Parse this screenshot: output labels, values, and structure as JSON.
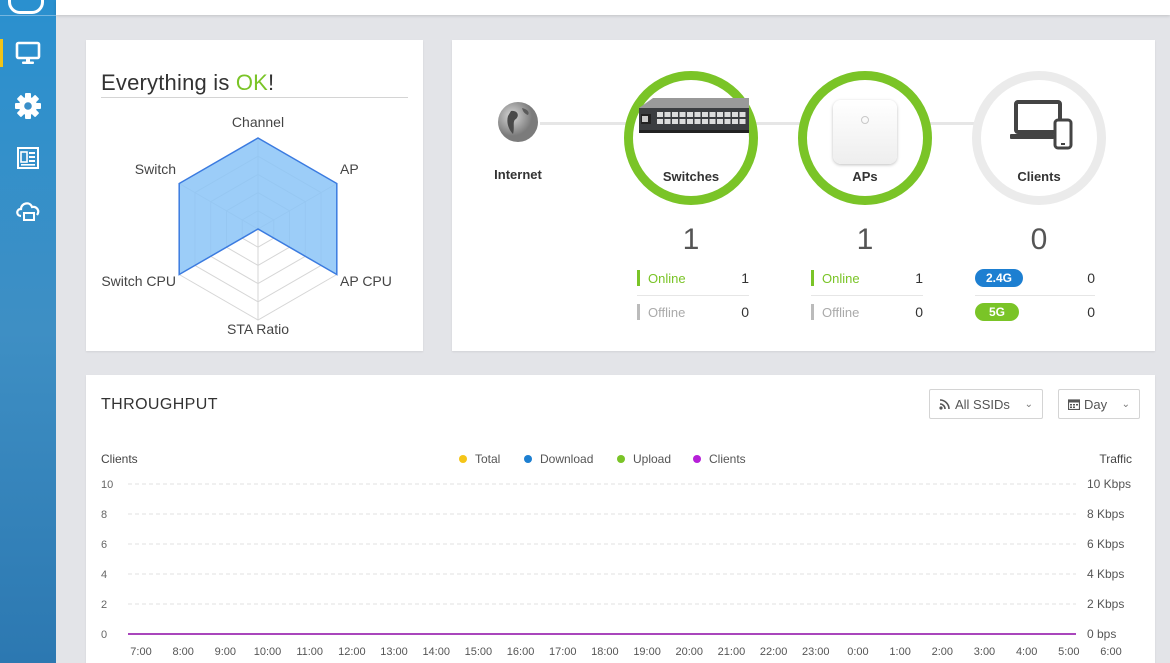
{
  "sidebar": {
    "items": [
      {
        "name": "monitor-icon",
        "active": true
      },
      {
        "name": "gear-icon",
        "active": false
      },
      {
        "name": "logs-icon",
        "active": false
      },
      {
        "name": "cloud-icon",
        "active": false
      }
    ]
  },
  "health": {
    "title_prefix": "Everything is ",
    "title_status": "OK",
    "title_suffix": "!",
    "radar": {
      "axes": [
        "Channel",
        "AP",
        "AP CPU",
        "STA Ratio",
        "Switch CPU",
        "Switch"
      ],
      "values": [
        1.0,
        1.0,
        1.0,
        0.0,
        1.0,
        1.0
      ],
      "fill_color": "#8bc4f7",
      "stroke_color": "#3b7be0"
    }
  },
  "topology": {
    "internet": {
      "label": "Internet"
    },
    "switches": {
      "label": "Switches",
      "count": "1",
      "online_label": "Online",
      "online": "1",
      "offline_label": "Offline",
      "offline": "0"
    },
    "aps": {
      "label": "APs",
      "count": "1",
      "online_label": "Online",
      "online": "1",
      "offline_label": "Offline",
      "offline": "0"
    },
    "clients": {
      "label": "Clients",
      "count": "0",
      "band1_label": "2.4G",
      "band1": "0",
      "band2_label": "5G",
      "band2": "0"
    },
    "colors": {
      "online": "#7ac427",
      "offline": "#bbbbbb",
      "band24": "#1d7fd1",
      "band5": "#7ac427"
    }
  },
  "throughput": {
    "title": "THROUGHPUT",
    "ssid_select": "All SSIDs",
    "range_select": "Day",
    "left_axis_label": "Clients",
    "right_axis_label": "Traffic",
    "legend": [
      {
        "label": "Total",
        "color": "#f5c518"
      },
      {
        "label": "Download",
        "color": "#1d7fd1"
      },
      {
        "label": "Upload",
        "color": "#7ac427"
      },
      {
        "label": "Clients",
        "color": "#b620d8"
      }
    ]
  },
  "chart_data": {
    "type": "line",
    "title": "THROUGHPUT",
    "xlabel": "",
    "ylabel": "Clients",
    "y2label": "Traffic",
    "ylim": [
      0,
      10
    ],
    "y_ticks": [
      "0",
      "2",
      "4",
      "6",
      "8",
      "10"
    ],
    "y2_ticks": [
      "0 bps",
      "2 Kbps",
      "4 Kbps",
      "6 Kbps",
      "8 Kbps",
      "10 Kbps"
    ],
    "x": [
      "7:00",
      "8:00",
      "9:00",
      "10:00",
      "11:00",
      "12:00",
      "13:00",
      "14:00",
      "15:00",
      "16:00",
      "17:00",
      "18:00",
      "19:00",
      "20:00",
      "21:00",
      "22:00",
      "23:00",
      "0:00",
      "1:00",
      "2:00",
      "3:00",
      "4:00",
      "5:00",
      "6:00"
    ],
    "series": [
      {
        "name": "Total",
        "values": [
          0,
          0,
          0,
          0,
          0,
          0,
          0,
          0,
          0,
          0,
          0,
          0,
          0,
          0,
          0,
          0,
          0,
          0,
          0,
          0,
          0,
          0,
          0,
          0
        ]
      },
      {
        "name": "Download",
        "values": [
          0,
          0,
          0,
          0,
          0,
          0,
          0,
          0,
          0,
          0,
          0,
          0,
          0,
          0,
          0,
          0,
          0,
          0,
          0,
          0,
          0,
          0,
          0,
          0
        ]
      },
      {
        "name": "Upload",
        "values": [
          0,
          0,
          0,
          0,
          0,
          0,
          0,
          0,
          0,
          0,
          0,
          0,
          0,
          0,
          0,
          0,
          0,
          0,
          0,
          0,
          0,
          0,
          0,
          0
        ]
      },
      {
        "name": "Clients",
        "values": [
          0,
          0,
          0,
          0,
          0,
          0,
          0,
          0,
          0,
          0,
          0,
          0,
          0,
          0,
          0,
          0,
          0,
          0,
          0,
          0,
          0,
          0,
          0,
          0
        ]
      }
    ],
    "grid": true,
    "legend_position": "top-center"
  }
}
